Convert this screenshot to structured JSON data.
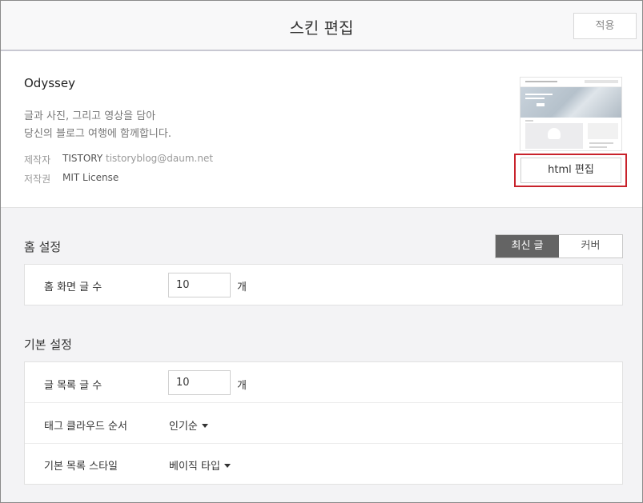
{
  "header": {
    "title": "스킨 편집",
    "apply_label": "적용"
  },
  "skin": {
    "name": "Odyssey",
    "desc_line1": "글과 사진, 그리고 영상을 담아",
    "desc_line2": "당신의 블로그 여행에 함께합니다.",
    "author_label": "제작자",
    "author_name": "TISTORY",
    "author_email": "tistoryblog@daum.net",
    "license_label": "저작권",
    "license_value": "MIT License",
    "edit_button_label": "html 편집"
  },
  "home_settings": {
    "title": "홈 설정",
    "tabs": [
      {
        "label": "최신 글",
        "active": true
      },
      {
        "label": "커버",
        "active": false
      }
    ],
    "post_count_label": "홈 화면 글 수",
    "post_count_value": "10",
    "post_count_unit": "개"
  },
  "basic_settings": {
    "title": "기본 설정",
    "list_count_label": "글 목록 글 수",
    "list_count_value": "10",
    "list_count_unit": "개",
    "tag_order_label": "태그 클라우드 순서",
    "tag_order_value": "인기순",
    "list_style_label": "기본 목록 스타일",
    "list_style_value": "베이직 타입"
  },
  "colors": {
    "active_tab": "#646464",
    "highlight": "#c8222b"
  }
}
